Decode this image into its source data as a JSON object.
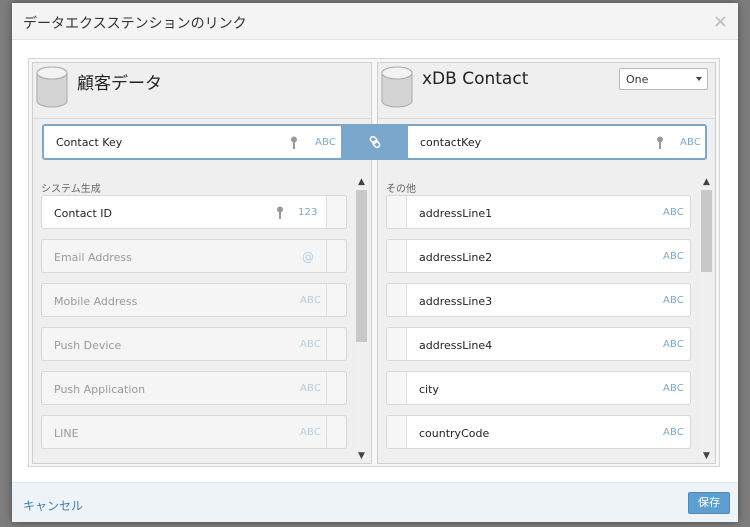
{
  "dialog": {
    "title": "データエクスステンションのリンク",
    "close_glyph": "×"
  },
  "left_panel": {
    "title": "顧客データ",
    "link_field": {
      "name": "Contact Key",
      "type": "ABC"
    },
    "section_label": "システム生成",
    "fields": [
      {
        "name": "Contact ID",
        "type": "123",
        "key": true,
        "disabled": false
      },
      {
        "name": "Email Address",
        "type": "@",
        "key": false,
        "disabled": true
      },
      {
        "name": "Mobile Address",
        "type": "ABC",
        "key": false,
        "disabled": true
      },
      {
        "name": "Push Device",
        "type": "ABC",
        "key": false,
        "disabled": true
      },
      {
        "name": "Push Application",
        "type": "ABC",
        "key": false,
        "disabled": true
      },
      {
        "name": "LINE",
        "type": "ABC",
        "key": false,
        "disabled": true
      }
    ]
  },
  "right_panel": {
    "title": "xDB Contact",
    "select_value": "One",
    "link_field": {
      "name": "contactKey",
      "type": "ABC"
    },
    "section_label": "その他",
    "fields": [
      {
        "name": "addressLine1",
        "type": "ABC"
      },
      {
        "name": "addressLine2",
        "type": "ABC"
      },
      {
        "name": "addressLine3",
        "type": "ABC"
      },
      {
        "name": "addressLine4",
        "type": "ABC"
      },
      {
        "name": "city",
        "type": "ABC"
      },
      {
        "name": "countryCode",
        "type": "ABC"
      }
    ]
  },
  "footer": {
    "cancel_label": "キャンセル",
    "save_label": "保存"
  },
  "colors": {
    "accent": "#7aa8cc",
    "link_text": "#3d7fb5",
    "save_button": "#5d9fd1"
  }
}
